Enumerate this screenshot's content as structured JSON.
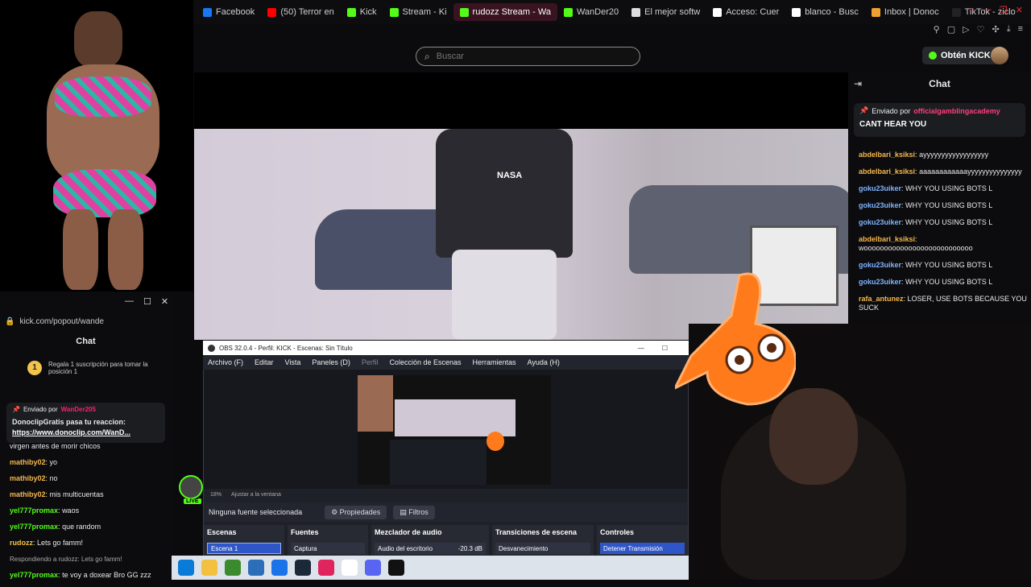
{
  "bookmarks": [
    {
      "label": "Facebook",
      "icon": "facebook-icon",
      "color": "#1877f2"
    },
    {
      "label": "(50) Terror en",
      "icon": "youtube-icon",
      "color": "#ff0000"
    },
    {
      "label": "Kick",
      "icon": "kick-icon",
      "color": "#53fc18"
    },
    {
      "label": "Stream - Ki",
      "icon": "kick-icon",
      "color": "#53fc18"
    },
    {
      "label": "rudozz Stream - Wa",
      "icon": "kick-icon",
      "color": "#53fc18",
      "active": true
    },
    {
      "label": "WanDer20",
      "icon": "kick-icon",
      "color": "#53fc18"
    },
    {
      "label": "El mejor softw",
      "icon": "app-icon",
      "color": "#dddddd"
    },
    {
      "label": "Acceso: Cuer",
      "icon": "google-icon",
      "color": "#ffffff"
    },
    {
      "label": "blanco - Busc",
      "icon": "google-icon",
      "color": "#ffffff"
    },
    {
      "label": "Inbox | Donoc",
      "icon": "inbox-icon",
      "color": "#f0a030"
    },
    {
      "label": "TikTok - ziclo",
      "icon": "tiktok-icon",
      "color": "#222222"
    }
  ],
  "search": {
    "placeholder": "Buscar"
  },
  "header": {
    "kicks_button": "Obtén KICKs"
  },
  "right_chat": {
    "title": "Chat",
    "pinned_by_label": "Enviado por",
    "pinned_user": "officialgamblingacademy",
    "pinned_message": "CANT HEAR YOU",
    "messages": [
      {
        "user": "abdelbari_ksiksi",
        "text": "ayyyyyyyyyyyyyyyyyy",
        "color": "#f5b74c"
      },
      {
        "user": "abdelbari_ksiksi",
        "text": "aaaaaaaaaaaayyyyyyyyyyyyyyy",
        "color": "#f5b74c"
      },
      {
        "user": "goku23uiker",
        "text": "WHY YOU USING BOTS L",
        "color": "#7fb3ff"
      },
      {
        "user": "goku23uiker",
        "text": "WHY YOU USING BOTS L",
        "color": "#7fb3ff"
      },
      {
        "user": "goku23uiker",
        "text": "WHY YOU USING BOTS L",
        "color": "#7fb3ff"
      },
      {
        "user": "abdelbari_ksiksi",
        "text": "wooooooooooooooooooooooooooo",
        "color": "#f5b74c"
      },
      {
        "user": "goku23uiker",
        "text": "WHY YOU USING BOTS L",
        "color": "#7fb3ff"
      },
      {
        "user": "goku23uiker",
        "text": "WHY YOU USING BOTS L",
        "color": "#7fb3ff"
      },
      {
        "user": "rafa_antunez",
        "text": "LOSER, USE BOTS BECAUSE YOU SUCK",
        "color": "#f5b74c"
      }
    ]
  },
  "popout": {
    "url": "kick.com/popout/wande",
    "chat_title": "Chat",
    "sub_banner": "Regala 1 suscripción para tomar la posición 1",
    "pinned_by_label": "Enviado por",
    "pinned_user": "WanDer205",
    "pinned_line1": "DonoclipGratis pasa tu reaccion:",
    "pinned_link": "https://www.donoclip.com/WanD...",
    "partial_line": "virgen antes de morir chicos",
    "messages": [
      {
        "user": "mathiby02",
        "text": "yo",
        "color": "#f5b74c"
      },
      {
        "user": "mathiby02",
        "text": "no",
        "color": "#f5b74c"
      },
      {
        "user": "mathiby02",
        "text": "mis multicuentas",
        "color": "#f5b74c"
      },
      {
        "user": "yel777promax",
        "text": "waos",
        "color": "#53fc18"
      },
      {
        "user": "yel777promax",
        "text": "que random",
        "color": "#53fc18"
      },
      {
        "user": "rudozz",
        "text": "Lets go famm!",
        "color": "#f5c542"
      },
      {
        "user": "",
        "text": "Respondiendo a rudozz: Lets go famm!",
        "color": "#aaaaaa"
      },
      {
        "user": "yel777promax",
        "text": "te voy a doxear Bro GG zzz",
        "color": "#53fc18"
      }
    ],
    "live_badge": "LIVE"
  },
  "obs": {
    "title": "OBS 32.0.4 - Perfil: KICK - Escenas: Sin Título",
    "menu": [
      "Archivo (F)",
      "Editar",
      "Vista",
      "Paneles (D)",
      "Perfil",
      "Colección de Escenas",
      "Herramientas",
      "Ayuda (H)"
    ],
    "zoom": "18%",
    "fit_label": "Ajustar a la ventana",
    "no_source": "Ninguna fuente seleccionada",
    "properties": "Propiedades",
    "filters": "Filtros",
    "docks": {
      "scenes": {
        "title": "Escenas",
        "item": "Escena 1"
      },
      "sources": {
        "title": "Fuentes",
        "item": "Captura"
      },
      "mixer": {
        "title": "Mezclador de audio",
        "item": "Audio del escritorio",
        "level": "-20.3 dB"
      },
      "transitions": {
        "title": "Transiciones de escena",
        "item": "Desvanecimiento"
      },
      "controls": {
        "title": "Controles",
        "item": "Detener Transmisión"
      }
    }
  },
  "taskbar": [
    "edge-icon",
    "folder-icon",
    "minecraft-icon",
    "calculator-icon",
    "mail-icon",
    "steam-icon",
    "tiktok-icon",
    "obs-icon",
    "discord-icon",
    "app-icon"
  ],
  "colors": {
    "kick_green": "#53fc18",
    "pin_pink": "#ff3f7a"
  }
}
